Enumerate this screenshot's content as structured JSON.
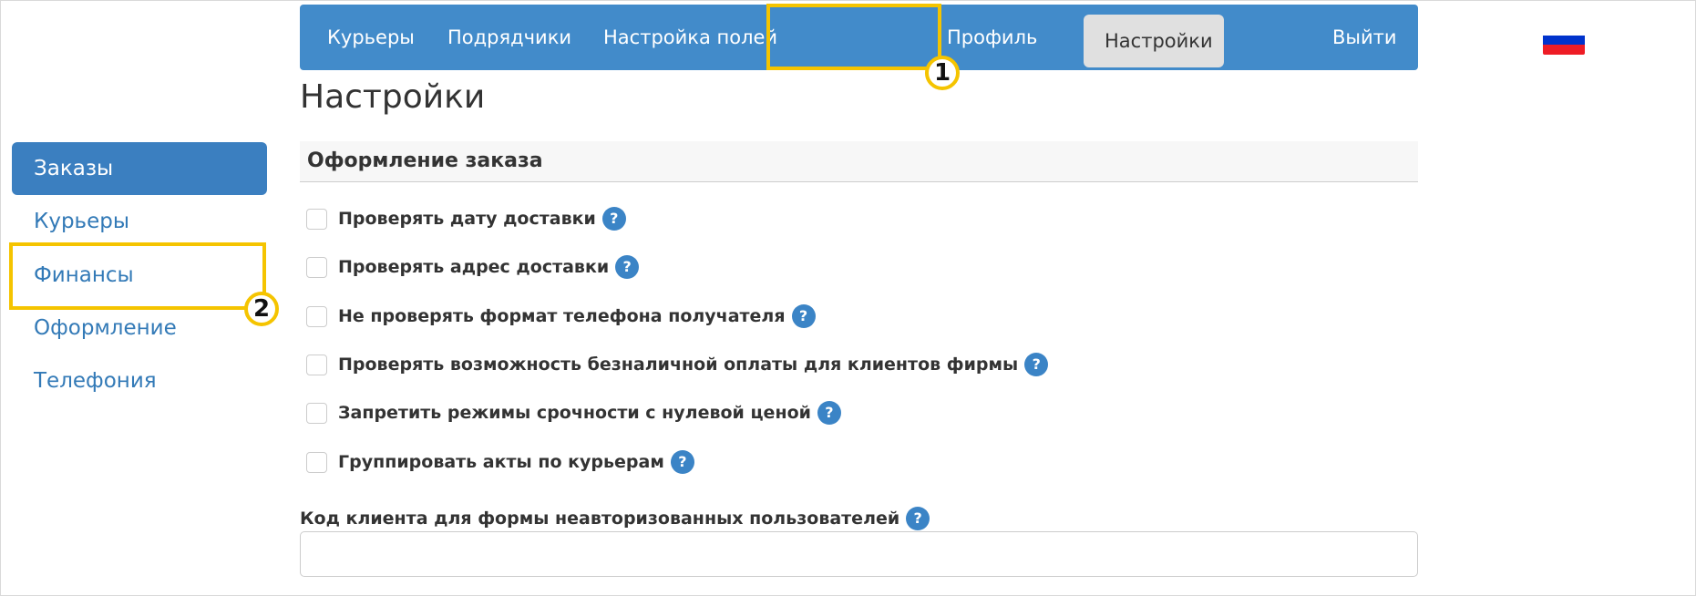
{
  "navbar": {
    "items": [
      "Курьеры",
      "Подрядчики",
      "Настройка полей",
      "Настройки",
      "Профиль"
    ],
    "active_index": 3,
    "logout": "Выйти",
    "flag_colors": [
      "#ffffff",
      "#0033cc",
      "#ee1c25"
    ]
  },
  "page_title": "Настройки",
  "sidebar": {
    "items": [
      "Заказы",
      "Курьеры",
      "Финансы",
      "Оформление",
      "Телефония"
    ],
    "active_index": 0
  },
  "section": {
    "title": "Оформление заказа",
    "options": [
      {
        "label": "Проверять дату доставки",
        "checked": false
      },
      {
        "label": "Проверять адрес доставки",
        "checked": false
      },
      {
        "label": "Не проверять формат телефона получателя",
        "checked": false
      },
      {
        "label": "Проверять возможность безналичной оплаты для клиентов фирмы",
        "checked": false
      },
      {
        "label": "Запретить режимы срочности с нулевой ценой",
        "checked": false
      },
      {
        "label": "Группировать акты по курьерам",
        "checked": false
      }
    ],
    "help_icon": "?"
  },
  "client_code": {
    "label": "Код клиента для формы неавторизованных пользователей",
    "value": ""
  },
  "annotations": {
    "badge1": "1",
    "badge2": "2",
    "highlight_color": "#f5c400"
  },
  "colors": {
    "navbar": "#428bca",
    "sidebar_active": "#3b7fc0",
    "link": "#337ab7",
    "help_icon": "#3b84c6"
  }
}
